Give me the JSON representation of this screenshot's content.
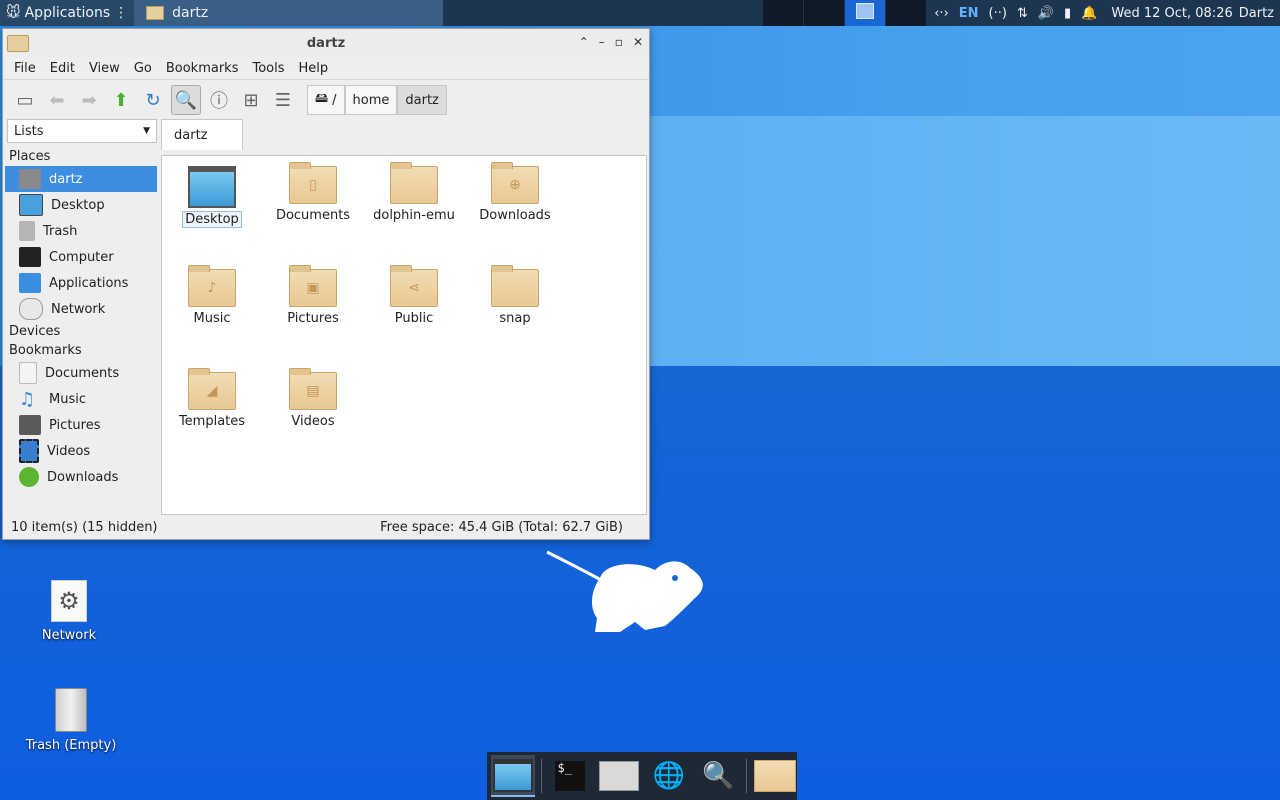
{
  "panel": {
    "apps_label": "Applications",
    "task_label": "dartz",
    "lang": "EN",
    "clock": "Wed 12 Oct, 08:26",
    "user": "Dartz"
  },
  "window": {
    "title": "dartz",
    "menus": [
      "File",
      "Edit",
      "View",
      "Go",
      "Bookmarks",
      "Tools",
      "Help"
    ],
    "crumbs": [
      "/",
      "home",
      "dartz"
    ],
    "sidebar_mode": "Lists",
    "tab": "dartz",
    "places_header": "Places",
    "places": [
      "dartz",
      "Desktop",
      "Trash",
      "Computer",
      "Applications",
      "Network"
    ],
    "devices_header": "Devices",
    "bookmarks_header": "Bookmarks",
    "bookmarks": [
      "Documents",
      "Music",
      "Pictures",
      "Videos",
      "Downloads"
    ],
    "files": [
      "Desktop",
      "Documents",
      "dolphin-emu",
      "Downloads",
      "Music",
      "Pictures",
      "Public",
      "snap",
      "Templates",
      "Videos"
    ],
    "status_left": "10 item(s) (15 hidden)",
    "status_right": "Free space: 45.4 GiB (Total: 62.7 GiB)"
  },
  "desktop": {
    "icons": [
      "Network",
      "Trash (Empty)"
    ]
  },
  "colors": {
    "accent": "#3d8ee0",
    "panel": "#1d3550",
    "folder": "#e9c894"
  }
}
